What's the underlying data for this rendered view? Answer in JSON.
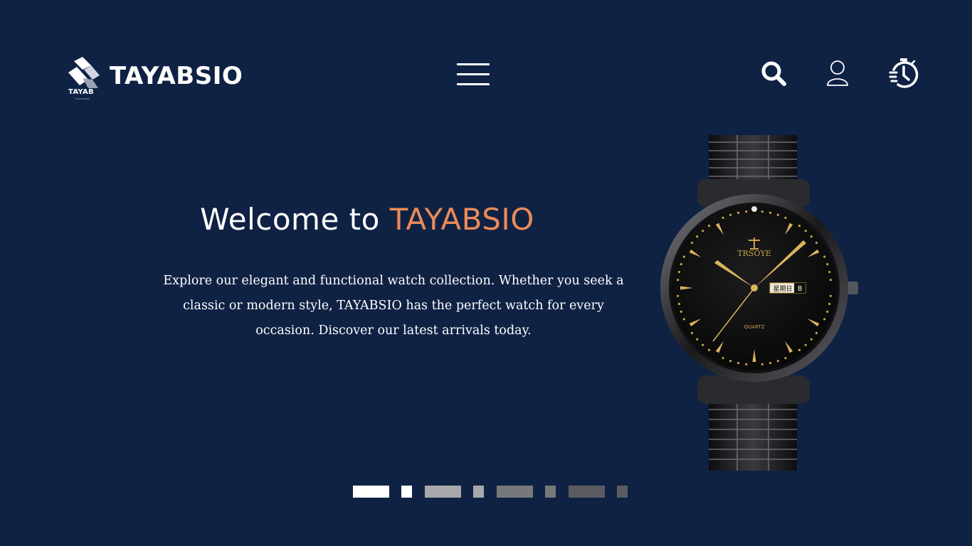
{
  "brand": {
    "mark_text": "TAYAB",
    "mark_subtext": "SOLUTIONS",
    "name": "TAYABSIO"
  },
  "header": {
    "menu_icon": "hamburger-menu-icon",
    "actions": [
      {
        "icon": "search-icon"
      },
      {
        "icon": "user-icon"
      },
      {
        "icon": "history-icon"
      }
    ]
  },
  "hero": {
    "title_prefix": "Welcome to ",
    "title_accent": "TAYABSIO",
    "description": "Explore our elegant and functional watch collection. Whether you seek a classic or modern style, TAYABSIO has the perfect watch for every occasion. Discover our latest arrivals today.",
    "product_image": {
      "brand": "TRSOYE",
      "dial_text": "QUARTZ",
      "date_window": "星期日",
      "date_number": "8"
    }
  },
  "slider": {
    "count": 8,
    "active_index": 0
  },
  "colors": {
    "background": "#0f2244",
    "accent": "#ea8b58",
    "text": "#ffffff"
  }
}
